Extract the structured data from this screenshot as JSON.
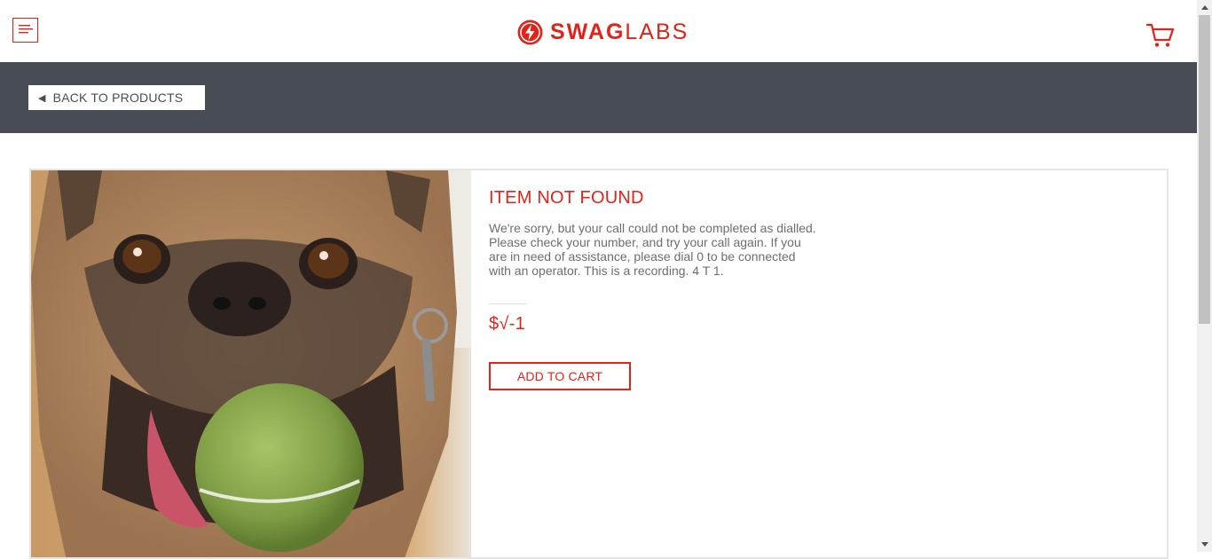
{
  "header": {
    "logo_bold": "SWAG",
    "logo_light": "LABS",
    "menu_icon": "hamburger-icon",
    "cart_icon": "cart-icon"
  },
  "subheader": {
    "back_label": "BACK TO PRODUCTS",
    "back_icon": "triangle-left-icon"
  },
  "item": {
    "name": "ITEM NOT FOUND",
    "description": "We're sorry, but your call could not be completed as dialled. Please check your number, and try your call again. If you are in need of assistance, please dial 0 to be connected with an operator. This is a recording. 4 T 1.",
    "price": "$√-1",
    "add_to_cart_label": "ADD TO CART",
    "image": "pug-with-tennis-ball"
  },
  "colors": {
    "accent": "#e2231a",
    "subheader_bg": "#474c55",
    "text_muted": "#6d6d6d"
  }
}
